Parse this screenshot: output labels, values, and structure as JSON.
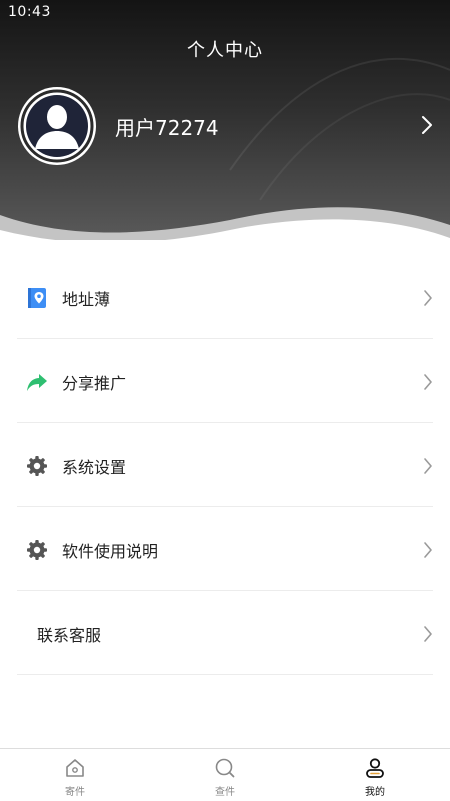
{
  "status_bar": {
    "time": "10:43"
  },
  "header": {
    "title": "个人中心",
    "username": "用户72274",
    "avatar_icon": "person-silhouette-icon"
  },
  "menu": {
    "items": [
      {
        "label": "地址薄",
        "icon": "address-book-icon",
        "icon_color": "#3d8ef5"
      },
      {
        "label": "分享推广",
        "icon": "share-arrow-icon",
        "icon_color": "#2fbf71"
      },
      {
        "label": "系统设置",
        "icon": "gear-icon",
        "icon_color": "#555555"
      },
      {
        "label": "软件使用说明",
        "icon": "gear-icon",
        "icon_color": "#555555"
      },
      {
        "label": "联系客服"
      }
    ]
  },
  "tabbar": {
    "tabs": [
      {
        "label": "寄件",
        "icon": "home-icon",
        "active": false
      },
      {
        "label": "查件",
        "icon": "search-icon",
        "active": false
      },
      {
        "label": "我的",
        "icon": "user-icon",
        "active": true
      }
    ]
  },
  "colors": {
    "header_dark": "#141414",
    "header_light": "#5a5a5a",
    "wave_grey": "#bdbdbd",
    "divider": "#ececec",
    "text": "#222222",
    "tab_inactive": "#888888"
  }
}
